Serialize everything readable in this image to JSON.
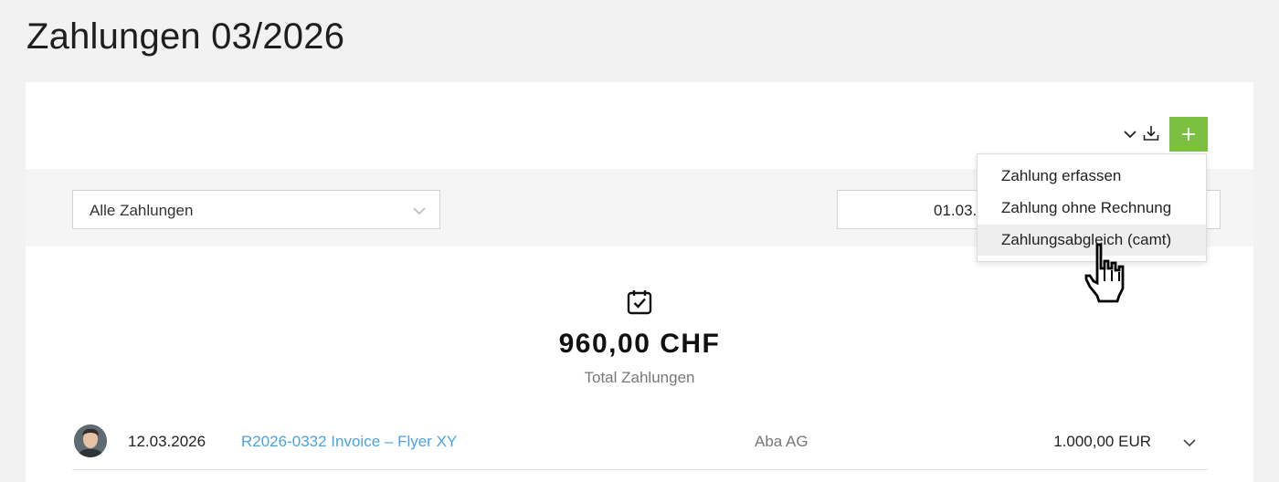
{
  "page": {
    "title": "Zahlungen 03/2026"
  },
  "toolbar": {
    "more_icon": "chevron-down-icon",
    "download_icon": "download-icon",
    "add_icon": "plus-icon",
    "add_color": "#7cc042"
  },
  "filters": {
    "payment_filter": "Alle Zahlungen",
    "date_from": "01.03."
  },
  "summary": {
    "icon": "calendar-check-icon",
    "total": "960,00 CHF",
    "label": "Total Zahlungen"
  },
  "payments": [
    {
      "date": "12.03.2026",
      "invoice": "R2026-0332 Invoice – Flyer XY",
      "customer": "Aba AG",
      "amount": "1.000,00 EUR"
    }
  ],
  "add_menu": {
    "items": [
      {
        "label": "Zahlung erfassen"
      },
      {
        "label": "Zahlung ohne Rechnung"
      },
      {
        "label": "Zahlungsabgleich (camt)"
      }
    ]
  },
  "colors": {
    "link": "#4aa3df",
    "accent": "#7cc042"
  }
}
